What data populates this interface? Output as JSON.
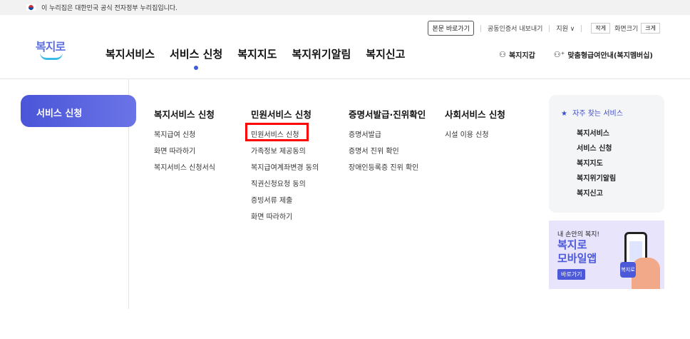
{
  "gov_bar": {
    "text": "이 누리집은 대한민국 공식 전자정부 누리집입니다."
  },
  "util": {
    "skip": "본문 바로가기",
    "cert": "공동인증서 내보내기",
    "support": "지원 ∨",
    "small": "작게",
    "zoom": "화면크기",
    "large": "크게"
  },
  "logo": {
    "text": "복지로"
  },
  "gnb": {
    "items": [
      "복지서비스",
      "서비스 신청",
      "복지지도",
      "복지위기알림",
      "복지신고"
    ]
  },
  "right_links": {
    "wallet": "복지지갑",
    "guide": "맞춤형급여안내(복지멤버십)"
  },
  "side": {
    "label": "서비스 신청"
  },
  "columns": [
    {
      "head": "복지서비스 신청",
      "links": [
        "복지급여 신청",
        "화면 따라하기",
        "복지서비스 신청서식"
      ]
    },
    {
      "head": "민원서비스 신청",
      "links": [
        "민원서비스 신청",
        "가족정보 제공동의",
        "복지급여계좌변경 동의",
        "직권신청요청 동의",
        "증빙서류 제출",
        "화면 따라하기"
      ]
    },
    {
      "head": "증명서발급·진위확인",
      "links": [
        "증명서발급",
        "증명서 진위 확인",
        "장애인등록증 진위 확인"
      ]
    },
    {
      "head": "사회서비스 신청",
      "links": [
        "시설 이용 신청"
      ]
    }
  ],
  "favorites": {
    "title": "자주 찾는 서비스",
    "items": [
      "복지서비스",
      "서비스 신청",
      "복지지도",
      "복지위기알림",
      "복지신고"
    ]
  },
  "banner": {
    "line1": "내 손안의 복지!",
    "line2": "복지로",
    "line3": "모바일앱",
    "button": "바로가기",
    "app_icon": "복지로"
  },
  "colors": {
    "accent": "#4a55d8",
    "highlight": "#ff0000",
    "logo_blue": "#3cbbe8"
  }
}
